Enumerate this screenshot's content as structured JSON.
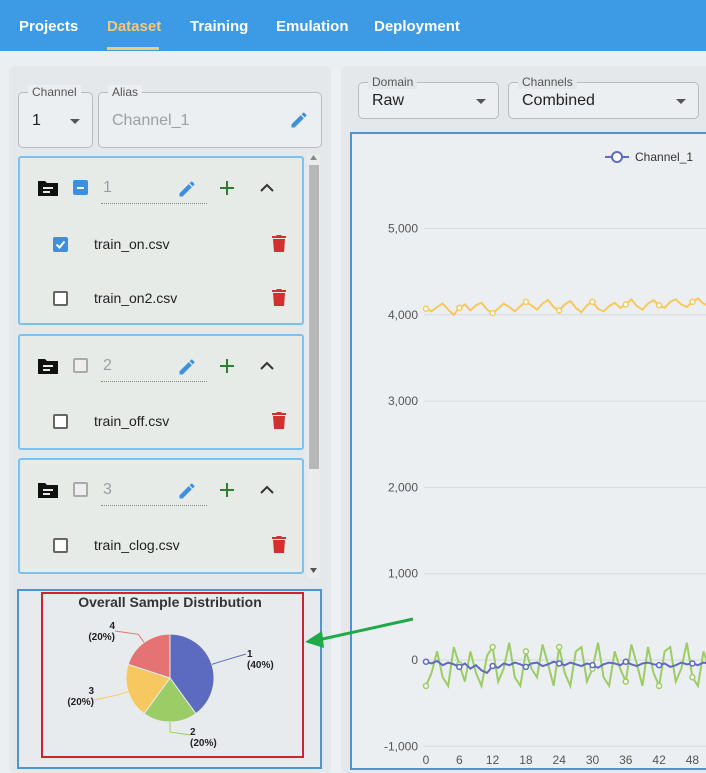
{
  "nav": {
    "tabs": [
      {
        "label": "Projects"
      },
      {
        "label": "Dataset"
      },
      {
        "label": "Training"
      },
      {
        "label": "Emulation"
      },
      {
        "label": "Deployment"
      }
    ],
    "active_tab": "Dataset",
    "bar_color": "#3d9be6",
    "active_color": "#f7c878"
  },
  "left": {
    "channel": {
      "label": "Channel",
      "value": "1"
    },
    "alias": {
      "label": "Alias",
      "placeholder": "Channel_1"
    },
    "groups": [
      {
        "name": "1",
        "checkbox": "indeterminate",
        "files": [
          {
            "name": "train_on.csv",
            "checked": true
          },
          {
            "name": "train_on2.csv",
            "checked": false
          }
        ]
      },
      {
        "name": "2",
        "checkbox": "unchecked",
        "files": [
          {
            "name": "train_off.csv",
            "checked": false
          }
        ]
      },
      {
        "name": "3",
        "checkbox": "unchecked",
        "files": [
          {
            "name": "train_clog.csv",
            "checked": false
          }
        ]
      }
    ],
    "pie": {
      "title": "Overall Sample Distribution",
      "slices": [
        {
          "label": "1",
          "pct": "(40%)",
          "value": 40,
          "color": "#5c6bc0"
        },
        {
          "label": "2",
          "pct": "(20%)",
          "value": 20,
          "color": "#9ccc65"
        },
        {
          "label": "3",
          "pct": "(20%)",
          "value": 20,
          "color": "#f6c85f"
        },
        {
          "label": "4",
          "pct": "(20%)",
          "value": 20,
          "color": "#e57373"
        }
      ]
    }
  },
  "right": {
    "domain": {
      "label": "Domain",
      "value": "Raw"
    },
    "channels": {
      "label": "Channels",
      "value": "Combined"
    },
    "legend": {
      "series_1": "Channel_1"
    }
  },
  "chart_data": {
    "type": "line",
    "title": "",
    "xlabel": "",
    "ylabel": "",
    "x_ticks": [
      "0",
      "6",
      "12",
      "18",
      "24",
      "30",
      "36",
      "42",
      "48"
    ],
    "y_ticks": [
      "5,000",
      "4,000",
      "3,000",
      "2,000",
      "1,000",
      "0",
      "-1,000"
    ],
    "ylim": [
      -1000,
      5500
    ],
    "series": [
      {
        "name": "Channel_1",
        "color": "#5c6bc0",
        "values": [
          -20,
          -40,
          -10,
          -60,
          -30,
          -50,
          -80,
          -40,
          -100,
          -60,
          -120,
          -150,
          -70,
          -90,
          -40,
          -60,
          -30,
          -50,
          -80,
          -40,
          -30,
          -70,
          -50,
          -20,
          -40,
          -60,
          -30,
          -50,
          -70,
          -40,
          -60,
          -90,
          -50,
          -30,
          -40,
          -60,
          -20,
          -50,
          -70,
          -40,
          -30,
          -50,
          -60,
          -40,
          -80,
          -60,
          -30,
          -50,
          -40,
          -60,
          -30,
          -40,
          -20
        ]
      },
      {
        "color": "#f6c85f",
        "values": [
          4070,
          4040,
          4090,
          4130,
          4060,
          4000,
          4080,
          4120,
          4050,
          4110,
          4140,
          4060,
          4020,
          4070,
          4130,
          4090,
          4040,
          4100,
          4150,
          4110,
          4060,
          4130,
          4170,
          4090,
          4050,
          4120,
          4160,
          4080,
          4030,
          4110,
          4150,
          4070,
          4040,
          4100,
          4140,
          4080,
          4120,
          4180,
          4100,
          4060,
          4130,
          4170,
          4110,
          4080,
          4150,
          4180,
          4120,
          4090,
          4150,
          4190,
          4130,
          4100,
          4160
        ]
      },
      {
        "color": "#9ccc65",
        "values": [
          -300,
          -150,
          100,
          -200,
          -300,
          150,
          -50,
          -250,
          100,
          -150,
          -300,
          50,
          150,
          -250,
          -100,
          200,
          -200,
          -300,
          100,
          -100,
          -200,
          180,
          -50,
          -300,
          150,
          -150,
          -300,
          100,
          150,
          -250,
          -100,
          200,
          -200,
          -300,
          100,
          -100,
          -250,
          180,
          -50,
          -300,
          150,
          -150,
          -300,
          100,
          150,
          -250,
          -100,
          200,
          -200,
          -300,
          100,
          -100,
          -250
        ]
      }
    ],
    "legend_position": "top",
    "grid": true
  }
}
